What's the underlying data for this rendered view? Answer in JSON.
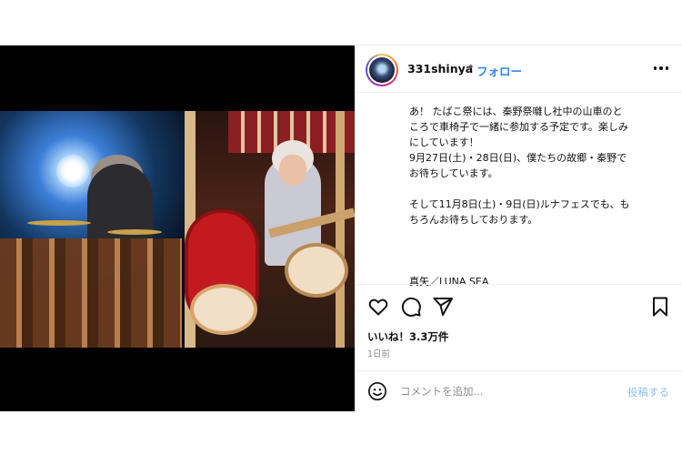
{
  "header": {
    "username": "331shinya",
    "separator": "•",
    "follow_label": "フォロー"
  },
  "caption": {
    "lines": [
      "あ！ たばこ祭には、秦野祭囃し社中の山車のと",
      "ころで車椅子で一緒に参加する予定です。楽しみ",
      "にしています！",
      "9月27日(土)・28日(日)、僕たちの故郷・秦野で",
      "お待ちしています。",
      "そして11月8日(土)・9日(日)ルナフェスでも、も",
      "ちろんお待ちしております。"
    ],
    "signature": "真矢／LUNA SEA"
  },
  "actions": {
    "likes": "いいね！3.3万件",
    "time": "1日前"
  },
  "comment": {
    "placeholder": "コメントを追加...",
    "post_label": "投稿する"
  },
  "icons": {
    "like": "heart-icon",
    "comment": "comment-bubble-icon",
    "share": "paper-plane-icon",
    "save": "bookmark-icon",
    "emoji": "smiley-icon",
    "more": "more-dots-icon"
  },
  "colors": {
    "accent": "#2f86ef",
    "muted": "#8e8e8e",
    "post_button": "#8fbfee"
  }
}
